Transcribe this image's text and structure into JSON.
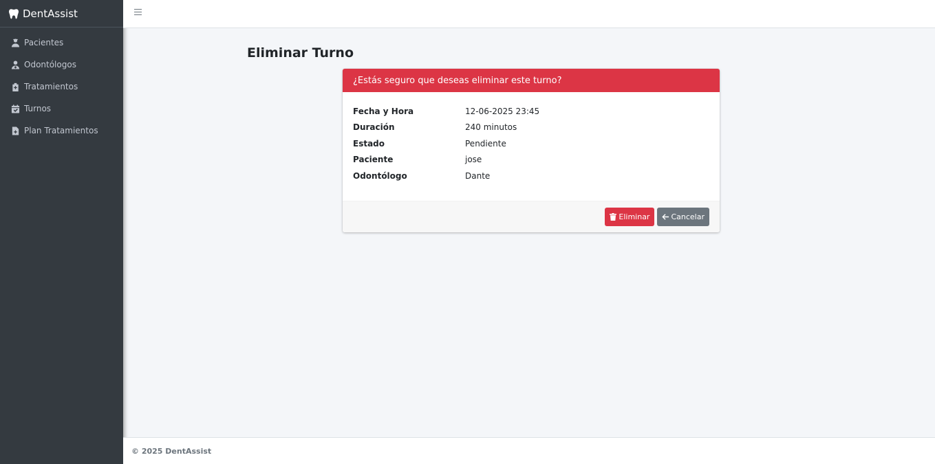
{
  "brand": {
    "name": "DentAssist",
    "icon": "tooth-icon"
  },
  "sidebar": {
    "items": [
      {
        "label": "Pacientes",
        "icon": "patient-icon"
      },
      {
        "label": "Odontólogos",
        "icon": "doctor-icon"
      },
      {
        "label": "Tratamientos",
        "icon": "medkit-icon"
      },
      {
        "label": "Turnos",
        "icon": "calendar-check-icon"
      },
      {
        "label": "Plan Tratamientos",
        "icon": "file-medical-icon"
      }
    ]
  },
  "topbar": {
    "menu_icon": "hamburger-icon"
  },
  "main": {
    "title": "Eliminar Turno",
    "card": {
      "header": "¿Estás seguro que deseas eliminar este turno?",
      "fields": [
        {
          "label": "Fecha y Hora",
          "value": "12-06-2025 23:45"
        },
        {
          "label": "Duración",
          "value": "240 minutos"
        },
        {
          "label": "Estado",
          "value": "Pendiente"
        },
        {
          "label": "Paciente",
          "value": "jose"
        },
        {
          "label": "Odontólogo",
          "value": "Dante"
        }
      ],
      "actions": {
        "delete_label": "Eliminar",
        "delete_icon": "trash-icon",
        "cancel_label": "Cancelar",
        "cancel_icon": "arrow-left-icon"
      }
    }
  },
  "footer": {
    "text": "© 2025 DentAssist"
  },
  "colors": {
    "danger": "#dc3545",
    "secondary": "#6c757d",
    "sidebar": "#343a40",
    "background": "#f4f6f9"
  }
}
